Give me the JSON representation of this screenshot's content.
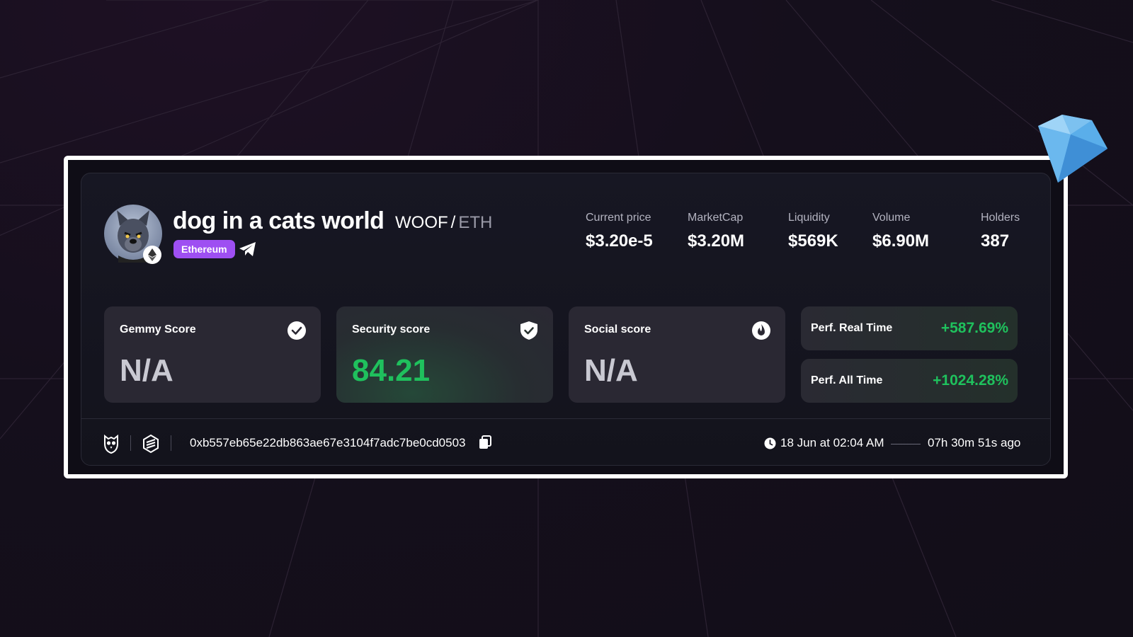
{
  "token": {
    "name": "dog in a cats world",
    "base": "WOOF",
    "separator": "/",
    "quote": "ETH",
    "chain": "Ethereum"
  },
  "stats": [
    {
      "label": "Current price",
      "value": "$3.20e-5"
    },
    {
      "label": "MarketCap",
      "value": "$3.20M"
    },
    {
      "label": "Liquidity",
      "value": "$569K"
    },
    {
      "label": "Volume",
      "value": "$6.90M"
    },
    {
      "label": "Holders",
      "value": "387"
    }
  ],
  "scores": {
    "gemmy": {
      "label": "Gemmy Score",
      "value": "N/A"
    },
    "security": {
      "label": "Security score",
      "value": "84.21"
    },
    "social": {
      "label": "Social score",
      "value": "N/A"
    }
  },
  "performance": {
    "real_time": {
      "label": "Perf. Real Time",
      "value": "+587.69%"
    },
    "all_time": {
      "label": "Perf. All Time",
      "value": "+1024.28%"
    }
  },
  "footer": {
    "address": "0xb557eb65e22db863ae67e3104f7adc7be0cd0503",
    "date": "18 Jun at 02:04 AM",
    "ago": "07h 30m 51s ago"
  },
  "colors": {
    "positive": "#1fc15d",
    "chain_tag": "#9e4ff2",
    "gem": "#5aaeea"
  },
  "icons": [
    "eth-icon",
    "telegram-icon",
    "check-circle-icon",
    "shield-check-icon",
    "fire-icon",
    "owl-icon",
    "dextools-icon",
    "copy-icon",
    "clock-icon",
    "diamond-icon"
  ]
}
